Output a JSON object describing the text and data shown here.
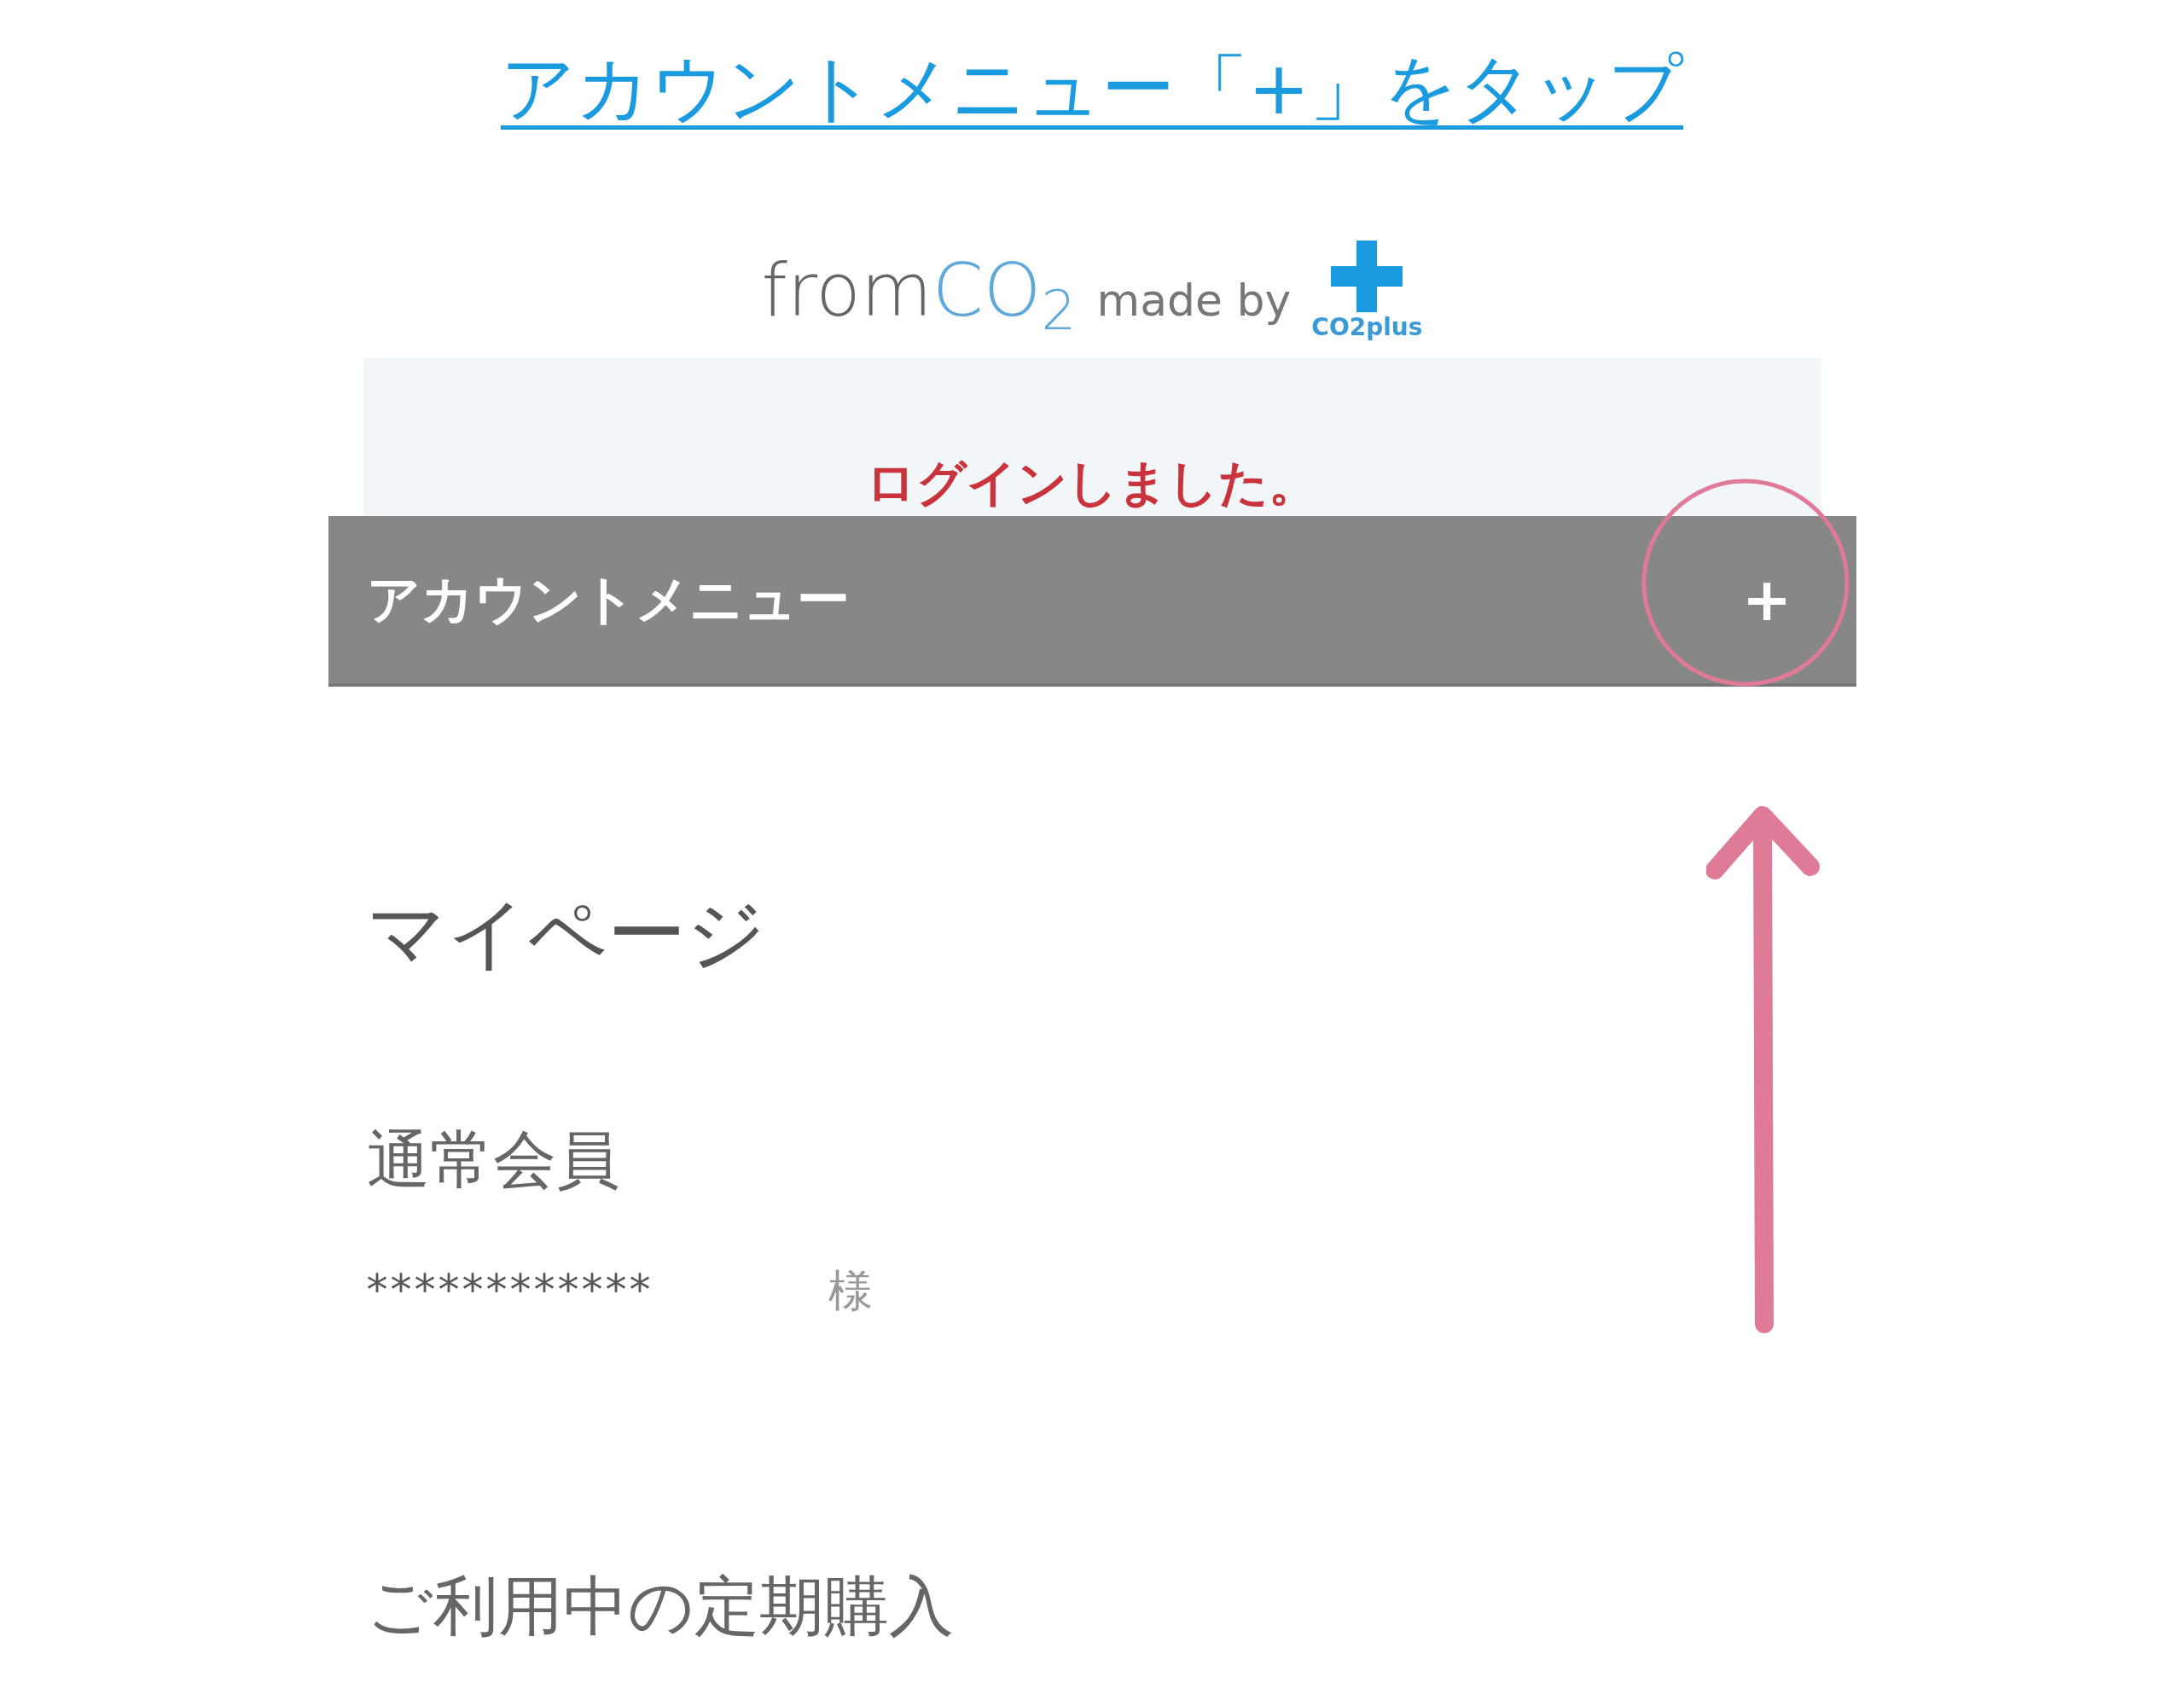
{
  "instruction": {
    "text": "アカウントメニュー「+」をタップ"
  },
  "logo": {
    "brand_prefix": "from",
    "brand_highlight": "CO$_{2}$",
    "made_by": "made by",
    "maker": "CO2plus"
  },
  "alert": {
    "message": "ログインしました。"
  },
  "account_menu": {
    "label": "アカウントメニュー",
    "toggle": "+"
  },
  "mypage": {
    "title": "マイページ",
    "membership": "通常会員",
    "member_name": "************",
    "honorific": "様",
    "section_heading": "ご利用中の定期購入"
  },
  "highlight_circle": {
    "color": "#e07b97"
  },
  "pointer_arrow": {
    "color": "#e07b97"
  }
}
